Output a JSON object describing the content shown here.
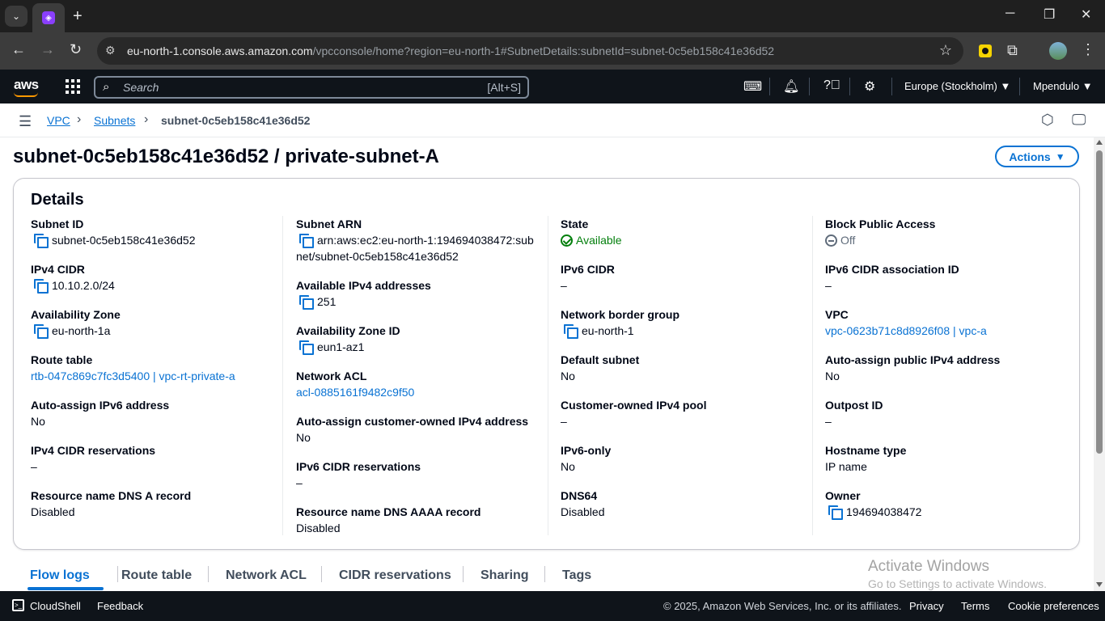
{
  "browser": {
    "url_host": "eu-north-1.console.aws.amazon.com",
    "url_path": "/vpcconsole/home?region=eu-north-1#SubnetDetails:subnetId=subnet-0c5eb158c41e36d52",
    "new_tab_glyph": "+",
    "minimize_glyph": "─",
    "restore_glyph": "❐",
    "close_glyph": "✕"
  },
  "aws_nav": {
    "logo": "aws",
    "search_placeholder": "Search",
    "search_shortcut": "[Alt+S]",
    "region": "Europe (Stockholm) ▼",
    "user": "Mpendulo ▼"
  },
  "breadcrumb": {
    "items": [
      "VPC",
      "Subnets",
      "subnet-0c5eb158c41e36d52"
    ]
  },
  "page": {
    "title": "subnet-0c5eb158c41e36d52 / private-subnet-A",
    "actions_label": "Actions"
  },
  "details": {
    "title": "Details",
    "col1": [
      {
        "label": "Subnet ID",
        "value": "subnet-0c5eb158c41e36d52"
      },
      {
        "label": "IPv4 CIDR",
        "value": "10.10.2.0/24"
      },
      {
        "label": "Availability Zone",
        "value": "eu-north-1a"
      },
      {
        "label": "Route table",
        "value": "rtb-047c869c7fc3d5400 | vpc-rt-private-a"
      },
      {
        "label": "Auto-assign IPv6 address",
        "value": "No"
      },
      {
        "label": "IPv4 CIDR reservations",
        "value": "–"
      },
      {
        "label": "Resource name DNS A record",
        "value": "Disabled"
      }
    ],
    "col2": [
      {
        "label": "Subnet ARN",
        "value": "arn:aws:ec2:eu-north-1:194694038472:subnet/subnet-0c5eb158c41e36d52"
      },
      {
        "label": "Available IPv4 addresses",
        "value": "251"
      },
      {
        "label": "Availability Zone ID",
        "value": "eun1-az1"
      },
      {
        "label": "Network ACL",
        "value": "acl-0885161f9482c9f50"
      },
      {
        "label": "Auto-assign customer-owned IPv4 address",
        "value": "No"
      },
      {
        "label": "IPv6 CIDR reservations",
        "value": "–"
      },
      {
        "label": "Resource name DNS AAAA record",
        "value": "Disabled"
      }
    ],
    "col3": [
      {
        "label": "State",
        "value": "Available"
      },
      {
        "label": "IPv6 CIDR",
        "value": "–"
      },
      {
        "label": "Network border group",
        "value": "eu-north-1"
      },
      {
        "label": "Default subnet",
        "value": "No"
      },
      {
        "label": "Customer-owned IPv4 pool",
        "value": "–"
      },
      {
        "label": "IPv6-only",
        "value": "No"
      },
      {
        "label": "DNS64",
        "value": "Disabled"
      }
    ],
    "col4": [
      {
        "label": "Block Public Access",
        "value": "Off"
      },
      {
        "label": "IPv6 CIDR association ID",
        "value": "–"
      },
      {
        "label": "VPC",
        "value": "vpc-0623b71c8d8926f08 | vpc-a"
      },
      {
        "label": "Auto-assign public IPv4 address",
        "value": "No"
      },
      {
        "label": "Outpost ID",
        "value": "–"
      },
      {
        "label": "Hostname type",
        "value": "IP name"
      },
      {
        "label": "Owner",
        "value": "194694038472"
      }
    ]
  },
  "tabs": [
    "Flow logs",
    "Route table",
    "Network ACL",
    "CIDR reservations",
    "Sharing",
    "Tags"
  ],
  "watermark": {
    "line1": "Activate Windows",
    "line2": "Go to Settings to activate Windows."
  },
  "footer": {
    "cloudshell": "CloudShell",
    "feedback": "Feedback",
    "copyright": "© 2025, Amazon Web Services, Inc. or its affiliates.",
    "privacy": "Privacy",
    "terms": "Terms",
    "cookies": "Cookie preferences"
  },
  "colors": {
    "link": "#0972d3",
    "success": "#037f0c",
    "nav_bg": "#0f141a",
    "brand_orange": "#ff9900"
  }
}
